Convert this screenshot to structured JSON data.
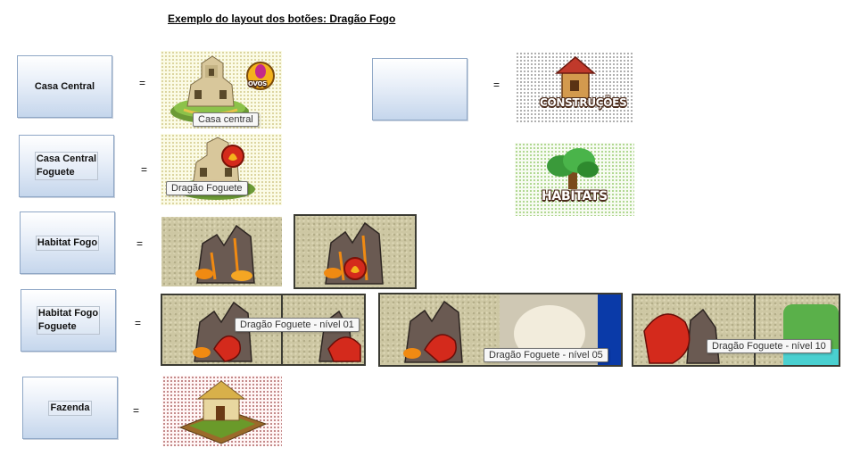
{
  "title": "Exemplo do layout dos botões:  Dragão Fogo",
  "buttons": {
    "casa_central": "Casa Central",
    "casa_central_foguete_1": "Casa Central",
    "casa_central_foguete_2": "Foguete",
    "habitat_fogo": "Habitat Fogo",
    "habitat_fogo_foguete_1": "Habitat Fogo",
    "habitat_fogo_foguete_2": "Foguete",
    "fazenda": "Fazenda",
    "blank": ""
  },
  "equals": "=",
  "tooltips": {
    "casa_central": "Casa central",
    "dragao_foguete": "Dragão Foguete",
    "nivel_01": "Dragão Foguete - nível 01",
    "nivel_05": "Dragão Foguete - nível 05",
    "nivel_10": "Dragão Foguete - nível 10"
  },
  "badges": {
    "ovos": "OVOS"
  },
  "signs": {
    "construcoes": "CONSTRUÇÕES",
    "habitats": "HABITATS"
  },
  "colors": {
    "button_border": "#8fa7c6",
    "button_fill_bottom": "#c5d6ec",
    "dragon_red": "#d42a1c",
    "lava": "#f08a12"
  }
}
